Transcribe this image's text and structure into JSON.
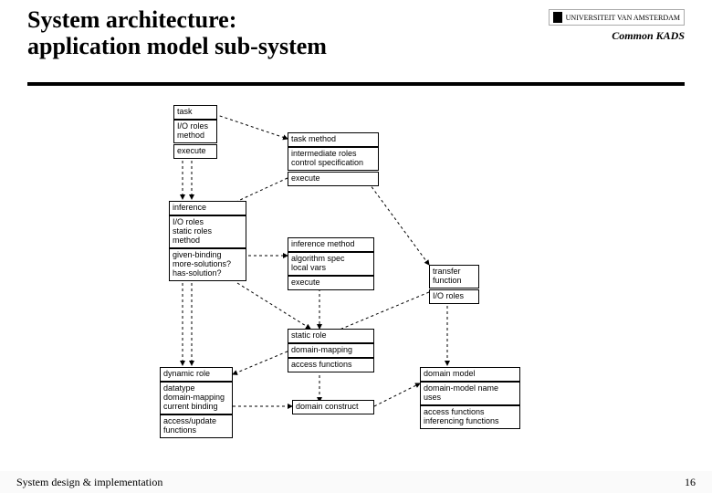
{
  "title_line1": "System architecture:",
  "title_line2": "application model sub-system",
  "logo_univ": "UNIVERSITEIT VAN AMSTERDAM",
  "logo_ck": "Common KADS",
  "footer_left": "System design & implementation",
  "footer_right": "16",
  "boxes": {
    "task": "task",
    "task_io": "I/O roles\nmethod",
    "task_exec": "execute",
    "task_method": "task method",
    "task_method_body": "intermediate roles\ncontrol specification",
    "task_method_exec": "execute",
    "inference": "inference",
    "inference_body": "I/O roles\nstatic roles\nmethod",
    "inference_q": "given-binding\nmore-solutions?\nhas-solution?",
    "inference_method": "inference method",
    "inference_method_body": "algorithm spec\nlocal vars",
    "inference_method_exec": "execute",
    "transfer": "transfer\nfunction",
    "transfer_io": "I/O roles",
    "static_role": "static role",
    "domain_mapping": "domain-mapping",
    "static_access": "access functions",
    "dynamic_role": "dynamic role",
    "dynamic_body": "datatype\ndomain-mapping\ncurrent binding",
    "dynamic_access": "access/update\nfunctions",
    "domain_construct": "domain construct",
    "domain_model": "domain model",
    "domain_model_body": "domain-model name\nuses",
    "domain_model_access": "access functions\ninferencing functions"
  }
}
